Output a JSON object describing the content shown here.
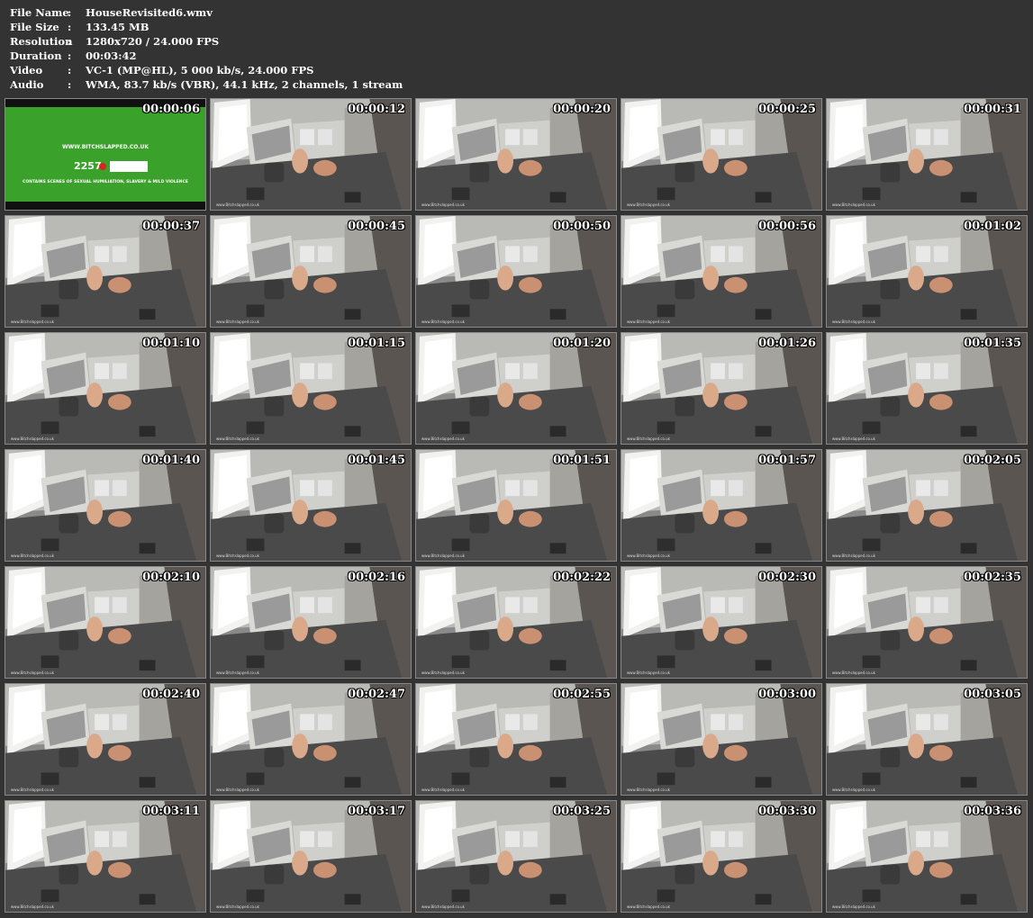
{
  "info": [
    {
      "label": "File Name",
      "sep": ":",
      "value": "HouseRevisited6.wmv"
    },
    {
      "label": "File Size",
      "sep": ":",
      "value": "133.45 MB"
    },
    {
      "label": "Resolution",
      "sep": ":",
      "value": "1280x720 / 24.000 FPS"
    },
    {
      "label": "Duration",
      "sep": ":",
      "value": "00:03:42"
    },
    {
      "label": "Video",
      "sep": ":",
      "value": "VC-1 (MP@HL), 5 000 kb/s, 24.000 FPS"
    },
    {
      "label": "Audio",
      "sep": ":",
      "value": "WMA, 83.7 kb/s (VBR), 44.1 kHz, 2 channels, 1 stream"
    }
  ],
  "title_card": {
    "url": "WWW.BITCHSLAPPED.CO.UK",
    "code": "2257",
    "warning": "CONTAINS SCENES OF SEXUAL HUMILIATION, SLAVERY & MILD VIOLENCE"
  },
  "thumbnails": [
    "00:00:06",
    "00:00:12",
    "00:00:20",
    "00:00:25",
    "00:00:31",
    "00:00:37",
    "00:00:45",
    "00:00:50",
    "00:00:56",
    "00:01:02",
    "00:01:10",
    "00:01:15",
    "00:01:20",
    "00:01:26",
    "00:01:35",
    "00:01:40",
    "00:01:45",
    "00:01:51",
    "00:01:57",
    "00:02:05",
    "00:02:10",
    "00:02:16",
    "00:02:22",
    "00:02:30",
    "00:02:35",
    "00:02:40",
    "00:02:47",
    "00:02:55",
    "00:03:00",
    "00:03:05",
    "00:03:11",
    "00:03:17",
    "00:03:25",
    "00:03:30",
    "00:03:36"
  ]
}
